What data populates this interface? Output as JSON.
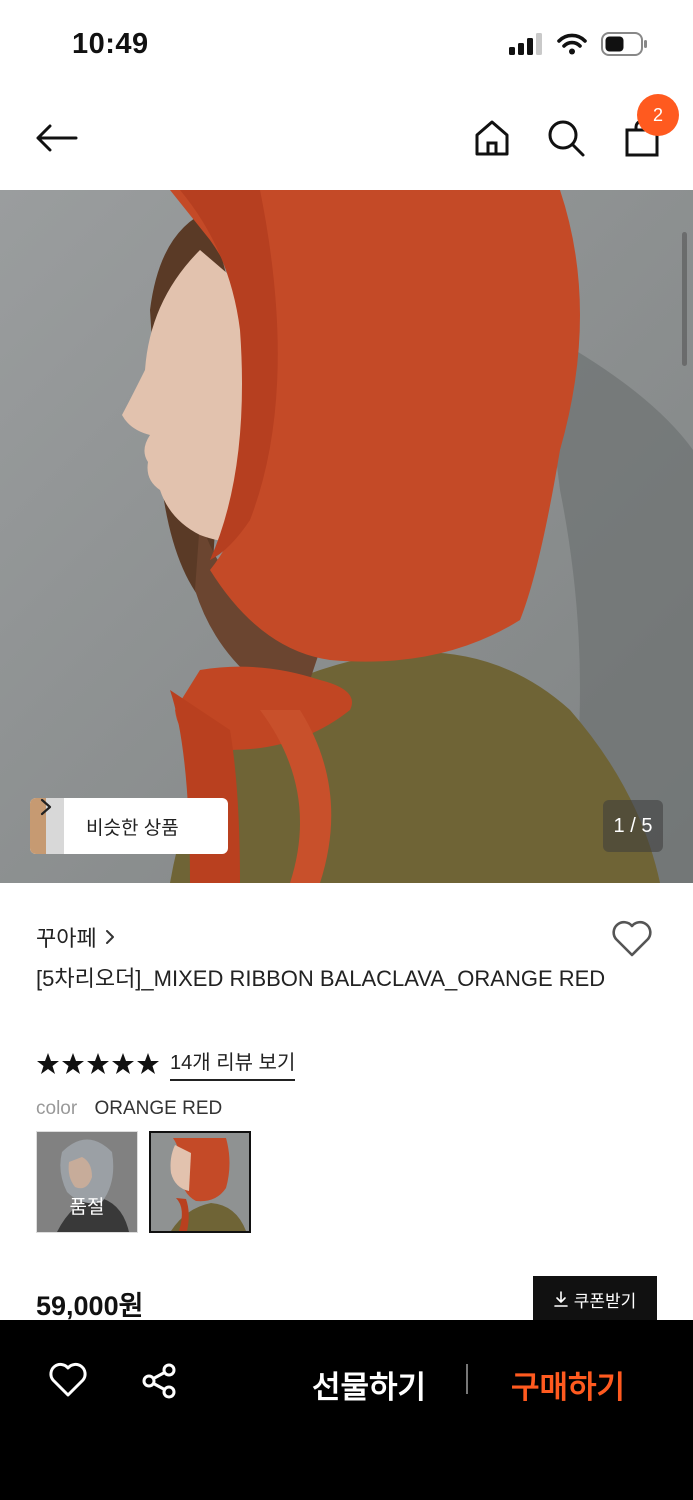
{
  "status_bar": {
    "time": "10:49"
  },
  "nav": {
    "cart_count": "2"
  },
  "hero": {
    "similar_label": "비슷한 상품",
    "counter": "1 / 5"
  },
  "product": {
    "brand": "꾸아페",
    "title": "[5차리오더]_MIXED RIBBON BALACLAVA_ORANGE RED",
    "rating": 5,
    "review_link": "14개 리뷰 보기",
    "color_key": "color",
    "color_value": "ORANGE RED",
    "swatches": [
      {
        "status": "품절"
      },
      {
        "status": ""
      }
    ],
    "price": "59,000원",
    "coupon_label": "쿠폰받기"
  },
  "bottom_bar": {
    "gift_label": "선물하기",
    "buy_label": "구매하기",
    "accent_color": "#ff5a1f"
  },
  "icons": [
    "back-arrow-icon",
    "home-icon",
    "search-icon",
    "cart-icon",
    "heart-icon",
    "share-icon",
    "download-icon",
    "chevron-right-icon"
  ]
}
